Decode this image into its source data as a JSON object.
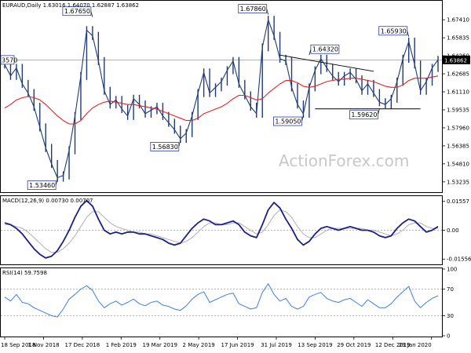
{
  "chart_data": [
    {
      "type": "line",
      "panel": "price",
      "title": "EURAUD,Daily 1.63016 1.64070 1.62887 1.63862",
      "watermark": "ActionForex.com",
      "ylim": [
        1.524,
        1.69
      ],
      "yticks": [
        "1.67410",
        "1.65835",
        "1.64260",
        "1.62685",
        "1.61110",
        "1.59535",
        "1.57960",
        "1.56385",
        "1.54810",
        "1.53235"
      ],
      "last_price": "1.63862",
      "left_tag": "3570",
      "xticks": [
        "18 Sep 2018",
        "1 Nov 2018",
        "17 Dec 2018",
        "1 Feb 2019",
        "19 Mar 2019",
        "2 May 2019",
        "17 Jun 2019",
        "31 Jul 2019",
        "13 Sep 2019",
        "29 Oct 2019",
        "12 Dec 2019",
        "29 Jan 2020"
      ],
      "callouts": [
        {
          "label": "1.67650",
          "value": 1.6765
        },
        {
          "label": "1.53460",
          "value": 1.5346
        },
        {
          "label": "1.56830",
          "value": 1.5683
        },
        {
          "label": "1.67860",
          "value": 1.6786
        },
        {
          "label": "1.59050",
          "value": 1.5905
        },
        {
          "label": "1.64320",
          "value": 1.6432
        },
        {
          "label": "1.59620",
          "value": 1.5962
        },
        {
          "label": "1.65930",
          "value": 1.6593
        }
      ],
      "series": [
        {
          "values": [
            1.635,
            1.625,
            1.632,
            1.618,
            1.61,
            1.598,
            1.58,
            1.562,
            1.548,
            1.536,
            1.538,
            1.56,
            1.59,
            1.625,
            1.665,
            1.66,
            1.638,
            1.612,
            1.6,
            1.604,
            1.596,
            1.59,
            1.605,
            1.6,
            1.592,
            1.595,
            1.598,
            1.59,
            1.584,
            1.578,
            1.57,
            1.575,
            1.59,
            1.61,
            1.628,
            1.61,
            1.615,
            1.62,
            1.63,
            1.638,
            1.618,
            1.608,
            1.598,
            1.592,
            1.65,
            1.674,
            1.66,
            1.64,
            1.638,
            1.615,
            1.6,
            1.592,
            1.615,
            1.63,
            1.64,
            1.632,
            1.625,
            1.62,
            1.625,
            1.628,
            1.622,
            1.612,
            1.618,
            1.61,
            1.602,
            1.6,
            1.605,
            1.62,
            1.64,
            1.655,
            1.635,
            1.612,
            1.62,
            1.632,
            1.639
          ]
        },
        {
          "values": [
            1.597,
            1.6,
            1.604,
            1.606,
            1.607,
            1.606,
            1.604,
            1.6,
            1.595,
            1.59,
            1.586,
            1.583,
            1.583,
            1.586,
            1.592,
            1.597,
            1.6,
            1.602,
            1.603,
            1.602,
            1.601,
            1.6,
            1.6,
            1.599,
            1.598,
            1.597,
            1.596,
            1.594,
            1.592,
            1.59,
            1.588,
            1.586,
            1.586,
            1.588,
            1.592,
            1.594,
            1.596,
            1.598,
            1.601,
            1.605,
            1.608,
            1.608,
            1.606,
            1.604,
            1.605,
            1.61,
            1.614,
            1.618,
            1.621,
            1.621,
            1.619,
            1.616,
            1.615,
            1.616,
            1.618,
            1.62,
            1.621,
            1.622,
            1.622,
            1.623,
            1.623,
            1.622,
            1.621,
            1.62,
            1.618,
            1.616,
            1.615,
            1.615,
            1.617,
            1.621,
            1.623,
            1.623,
            1.623,
            1.624,
            1.625
          ]
        }
      ]
    },
    {
      "type": "line",
      "panel": "macd",
      "title": "MACD(12,26,9) 0.00730 0.00707",
      "ylim": [
        -0.018,
        0.018
      ],
      "yticks": [
        "0.01557",
        "0.00",
        "-0.01556"
      ],
      "series": [
        {
          "values": [
            0.004,
            0.003,
            0.001,
            -0.002,
            -0.006,
            -0.01,
            -0.013,
            -0.015,
            -0.014,
            -0.011,
            -0.006,
            0.0,
            0.007,
            0.013,
            0.016,
            0.013,
            0.006,
            0.0,
            -0.002,
            -0.001,
            -0.002,
            -0.001,
            -0.001,
            -0.002,
            -0.002,
            -0.003,
            -0.004,
            -0.005,
            -0.007,
            -0.008,
            -0.007,
            -0.003,
            0.001,
            0.004,
            0.006,
            0.005,
            0.003,
            0.003,
            0.004,
            0.005,
            0.003,
            -0.001,
            -0.003,
            -0.004,
            0.003,
            0.011,
            0.015,
            0.012,
            0.006,
            0.001,
            -0.005,
            -0.008,
            -0.006,
            -0.002,
            0.001,
            0.002,
            0.001,
            0.0,
            0.001,
            0.002,
            0.001,
            0.0,
            0.0,
            -0.001,
            -0.003,
            -0.004,
            -0.003,
            0.001,
            0.004,
            0.006,
            0.005,
            0.002,
            -0.001,
            0.0,
            0.002
          ]
        },
        {
          "values": [
            0.003,
            0.003,
            0.002,
            0.001,
            -0.001,
            -0.004,
            -0.007,
            -0.01,
            -0.012,
            -0.012,
            -0.01,
            -0.007,
            -0.003,
            0.002,
            0.007,
            0.01,
            0.01,
            0.007,
            0.004,
            0.002,
            0.001,
            0.0,
            -0.001,
            -0.001,
            -0.002,
            -0.002,
            -0.003,
            -0.004,
            -0.005,
            -0.006,
            -0.007,
            -0.006,
            -0.004,
            -0.001,
            0.002,
            0.004,
            0.004,
            0.003,
            0.003,
            0.004,
            0.004,
            0.002,
            0.0,
            -0.002,
            -0.001,
            0.003,
            0.008,
            0.011,
            0.01,
            0.007,
            0.002,
            -0.002,
            -0.004,
            -0.004,
            -0.002,
            0.0,
            0.001,
            0.001,
            0.001,
            0.001,
            0.001,
            0.001,
            0.0,
            0.0,
            -0.001,
            -0.002,
            -0.003,
            -0.002,
            0.0,
            0.003,
            0.004,
            0.004,
            0.002,
            0.001,
            0.001
          ]
        }
      ]
    },
    {
      "type": "line",
      "panel": "rsi",
      "title": "RSI(14) 59.7598",
      "ylim": [
        0,
        100
      ],
      "yticks": [
        "100",
        "70",
        "30",
        "0"
      ],
      "levels": [
        70,
        30
      ],
      "series": [
        {
          "values": [
            58,
            52,
            62,
            50,
            48,
            42,
            38,
            34,
            30,
            28,
            40,
            55,
            62,
            70,
            75,
            68,
            52,
            42,
            48,
            52,
            46,
            50,
            55,
            48,
            45,
            50,
            52,
            46,
            44,
            40,
            38,
            45,
            55,
            62,
            66,
            50,
            54,
            58,
            62,
            64,
            48,
            44,
            40,
            42,
            65,
            78,
            62,
            52,
            56,
            44,
            40,
            44,
            58,
            62,
            65,
            56,
            52,
            50,
            54,
            56,
            50,
            44,
            54,
            48,
            42,
            42,
            48,
            58,
            66,
            74,
            52,
            42,
            50,
            56,
            60
          ]
        }
      ]
    }
  ]
}
